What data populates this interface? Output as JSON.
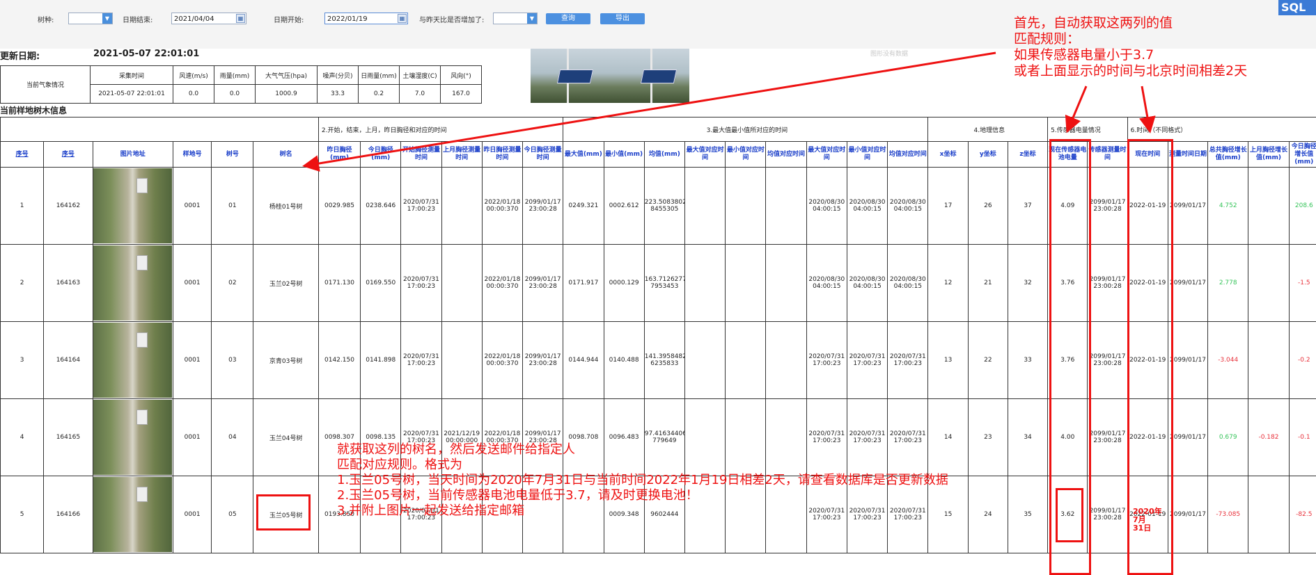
{
  "toolbar": {
    "species_label": "树种:",
    "end_date_label": "日期结束:",
    "end_date_value": "2021/04/04",
    "start_date_label": "日期开始:",
    "start_date_value": "2022/01/19",
    "compare_label": "与昨天比是否增加了:",
    "query_button": "查询",
    "export_button": "导出",
    "sql_badge": "SQL"
  },
  "update": {
    "label": "更新日期:",
    "value": "2021-05-07 22:01:01"
  },
  "weather": {
    "row_label": "当前气象情况",
    "headers": [
      "采集时间",
      "风速(m/s)",
      "雨量(mm)",
      "大气气压(hpa)",
      "噪声(分贝)",
      "日雨量(mm)",
      "土壤湿度(C)",
      "风向(°)"
    ],
    "values": [
      "2021-05-07 22:01:01",
      "0.0",
      "0.0",
      "1000.9",
      "33.3",
      "0.2",
      "7.0",
      "167.0"
    ]
  },
  "watermark": "图形没有数据",
  "section_title": "当前样地树木信息",
  "groups": {
    "g2": "2.开始，结束，上月，昨日胸径和对应的时间",
    "g3": "3.最大值最小值所对应的时间",
    "g4": "4.地理信息",
    "g5": "5.传感器电量情况",
    "g6": "6.时间（不同格式）"
  },
  "headers": [
    "序号",
    "序号",
    "图片地址",
    "样地号",
    "树号",
    "树名",
    "昨日胸径(mm)",
    "今日胸径(mm)",
    "开始胸径测量时间",
    "上月胸径测量时间",
    "昨日胸径测量时间",
    "今日胸径测量时间",
    "最大值(mm)",
    "最小值(mm)",
    "均值(mm)",
    "最大值对应时间",
    "最小值对应时间",
    "均值对应时间",
    "最大值对应时间",
    "最小值对应时间",
    "均值对应时间",
    "x坐标",
    "y坐标",
    "z坐标",
    "现在传感器电池电量",
    "传感器测量时间",
    "现在时间",
    "测量时间日期",
    "总共胸径增长值(mm)",
    "上月胸径增长值(mm)",
    "今日胸径增长值(mm)"
  ],
  "rows": [
    {
      "no": "1",
      "id": "164162",
      "plot": "0001",
      "tree_no": "01",
      "name": "杨桂01号树",
      "c": [
        "0029.985",
        "0238.646",
        "2020/07/31 17:00:23",
        "",
        "2022/01/18 00:00:370",
        "2099/01/17 23:00:28",
        "0249.321",
        "0002.612",
        "223.5083802 8455305",
        "",
        "",
        "",
        "2020/08/30 04:00:15",
        "2020/08/30 04:00:15",
        "2020/08/30 04:00:15",
        "17",
        "26",
        "37",
        "4.09",
        "2099/01/17 23:00:28",
        "2022-01-19",
        "2099/01/17",
        "4.752",
        "",
        "208.6"
      ]
    },
    {
      "no": "2",
      "id": "164163",
      "plot": "0001",
      "tree_no": "02",
      "name": "玉兰02号树",
      "c": [
        "0171.130",
        "0169.550",
        "2020/07/31 17:00:23",
        "",
        "2022/01/18 00:00:370",
        "2099/01/17 23:00:28",
        "0171.917",
        "0000.129",
        "163.7126277 7953453",
        "",
        "",
        "",
        "2020/08/30 04:00:15",
        "2020/08/30 04:00:15",
        "2020/08/30 04:00:15",
        "12",
        "21",
        "32",
        "3.76",
        "2099/01/17 23:00:28",
        "2022-01-19",
        "2099/01/17",
        "2.778",
        "",
        "-1.5"
      ]
    },
    {
      "no": "3",
      "id": "164164",
      "plot": "0001",
      "tree_no": "03",
      "name": "京青03号树",
      "c": [
        "0142.150",
        "0141.898",
        "2020/07/31 17:00:23",
        "",
        "2022/01/18 00:00:370",
        "2099/01/17 23:00:28",
        "0144.944",
        "0140.488",
        "141.3958482 6235833",
        "",
        "",
        "",
        "2020/07/31 17:00:23",
        "2020/07/31 17:00:23",
        "2020/07/31 17:00:23",
        "13",
        "22",
        "33",
        "3.76",
        "2099/01/17 23:00:28",
        "2022-01-19",
        "2099/01/17",
        "-3.044",
        "",
        "-0.2"
      ]
    },
    {
      "no": "4",
      "id": "164165",
      "plot": "0001",
      "tree_no": "04",
      "name": "玉兰04号树",
      "c": [
        "0098.307",
        "0098.135",
        "2020/07/31 17:00:23",
        "2021/12/19 00:00:000",
        "2022/01/18 00:00:370",
        "2099/01/17 23:00:28",
        "0098.708",
        "0096.483",
        "97.41634406 779649",
        "",
        "",
        "",
        "2020/07/31 17:00:23",
        "2020/07/31 17:00:23",
        "2020/07/31 17:00:23",
        "14",
        "23",
        "34",
        "4.00",
        "2099/01/17 23:00:28",
        "2022-01-19",
        "2099/01/17",
        "0.679",
        "-0.182",
        "-0.1"
      ]
    },
    {
      "no": "5",
      "id": "164166",
      "plot": "0001",
      "tree_no": "05",
      "name": "玉兰05号树",
      "c": [
        "0193.850",
        "",
        "2020/07/31 17:00:23",
        "",
        "",
        "",
        "",
        "0009.348",
        "9602444",
        "",
        "",
        "",
        "2020/07/31 17:00:23",
        "2020/07/31 17:00:23",
        "2020/07/31 17:00:23",
        "15",
        "24",
        "35",
        "3.62",
        "2099/01/17 23:00:28",
        "2022-01-19",
        "2099/01/17",
        "-73.085",
        "",
        "-82.5"
      ]
    }
  ],
  "annotations": {
    "top": [
      "首先，自动获取这两列的值",
      "匹配规则：",
      "如果传感器电量小于3.7",
      "或者上面显示的时间与北京时间相差2天"
    ],
    "bottom": [
      "就获取这列的树名，然后发送邮件给指定人",
      "匹配对应规则。格式为",
      "1.玉兰05号树，当天时间为2020年7月31日与当前时间2022年1月19日相差2天，请查看数据库是否更新数据",
      "2.玉兰05号树，当前传感器电池电量低于3.7，请及时更换电池！",
      "3.并附上图片一起发送给指定邮箱"
    ],
    "date_note": "2020年\n7月\n31日"
  }
}
